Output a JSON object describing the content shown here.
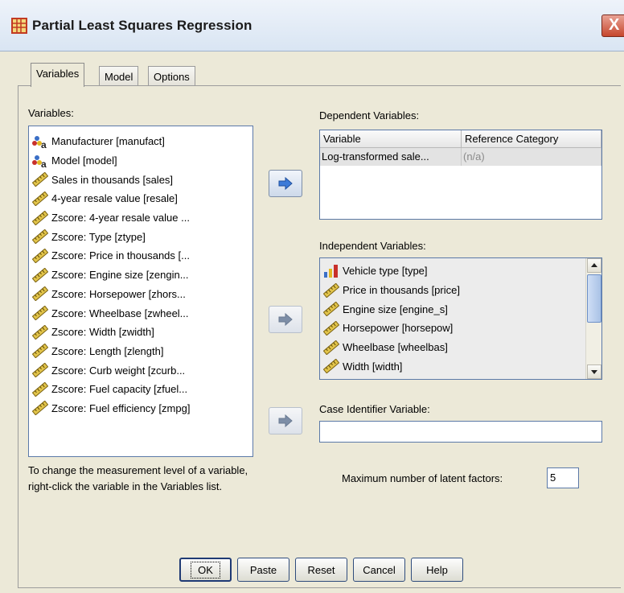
{
  "window": {
    "title": "Partial Least Squares Regression",
    "close_glyph": "X"
  },
  "tabs": [
    {
      "label": "Variables",
      "active": true
    },
    {
      "label": "Model",
      "active": false
    },
    {
      "label": "Options",
      "active": false
    }
  ],
  "variables": {
    "label": "Variables:",
    "items": [
      {
        "label": "Manufacturer [manufact]",
        "icon": "nominal-string-icon"
      },
      {
        "label": "Model [model]",
        "icon": "nominal-string-icon"
      },
      {
        "label": "Sales in thousands [sales]",
        "icon": "scale-ruler-icon"
      },
      {
        "label": "4-year resale value [resale]",
        "icon": "scale-ruler-icon"
      },
      {
        "label": "Zscore:  4-year resale value ...",
        "icon": "scale-ruler-icon"
      },
      {
        "label": "Zscore:  Type [ztype]",
        "icon": "scale-ruler-icon"
      },
      {
        "label": "Zscore:  Price in thousands [...",
        "icon": "scale-ruler-icon"
      },
      {
        "label": "Zscore:  Engine size [zengin...",
        "icon": "scale-ruler-icon"
      },
      {
        "label": "Zscore:  Horsepower [zhors...",
        "icon": "scale-ruler-icon"
      },
      {
        "label": "Zscore:  Wheelbase [zwheel...",
        "icon": "scale-ruler-icon"
      },
      {
        "label": "Zscore:  Width [zwidth]",
        "icon": "scale-ruler-icon"
      },
      {
        "label": "Zscore:  Length [zlength]",
        "icon": "scale-ruler-icon"
      },
      {
        "label": "Zscore:  Curb weight [zcurb...",
        "icon": "scale-ruler-icon"
      },
      {
        "label": "Zscore:  Fuel capacity [zfuel...",
        "icon": "scale-ruler-icon"
      },
      {
        "label": "Zscore:  Fuel efficiency [zmpg]",
        "icon": "scale-ruler-icon"
      }
    ],
    "hint": "To change the measurement level of a variable, right-click the variable in the Variables list."
  },
  "dependent": {
    "label": "Dependent Variables:",
    "columns": [
      "Variable",
      "Reference Category"
    ],
    "rows": [
      {
        "variable": "Log-transformed sale...",
        "reference": "(n/a)"
      }
    ]
  },
  "independent": {
    "label": "Independent Variables:",
    "items": [
      {
        "label": "Vehicle type [type]",
        "icon": "ordinal-bar-icon"
      },
      {
        "label": "Price in thousands [price]",
        "icon": "scale-ruler-icon"
      },
      {
        "label": "Engine size [engine_s]",
        "icon": "scale-ruler-icon"
      },
      {
        "label": "Horsepower [horsepow]",
        "icon": "scale-ruler-icon"
      },
      {
        "label": "Wheelbase [wheelbas]",
        "icon": "scale-ruler-icon"
      },
      {
        "label": "Width [width]",
        "icon": "scale-ruler-icon"
      }
    ]
  },
  "case_identifier": {
    "label": "Case Identifier Variable:",
    "value": ""
  },
  "latent": {
    "label": "Maximum number of latent factors:",
    "value": "5"
  },
  "buttons": {
    "ok": "OK",
    "paste": "Paste",
    "reset": "Reset",
    "cancel": "Cancel",
    "help": "Help"
  },
  "colors": {
    "accent": "#3d7bd8",
    "dialog_bg": "#ece9d8",
    "close": "#c6462d"
  }
}
